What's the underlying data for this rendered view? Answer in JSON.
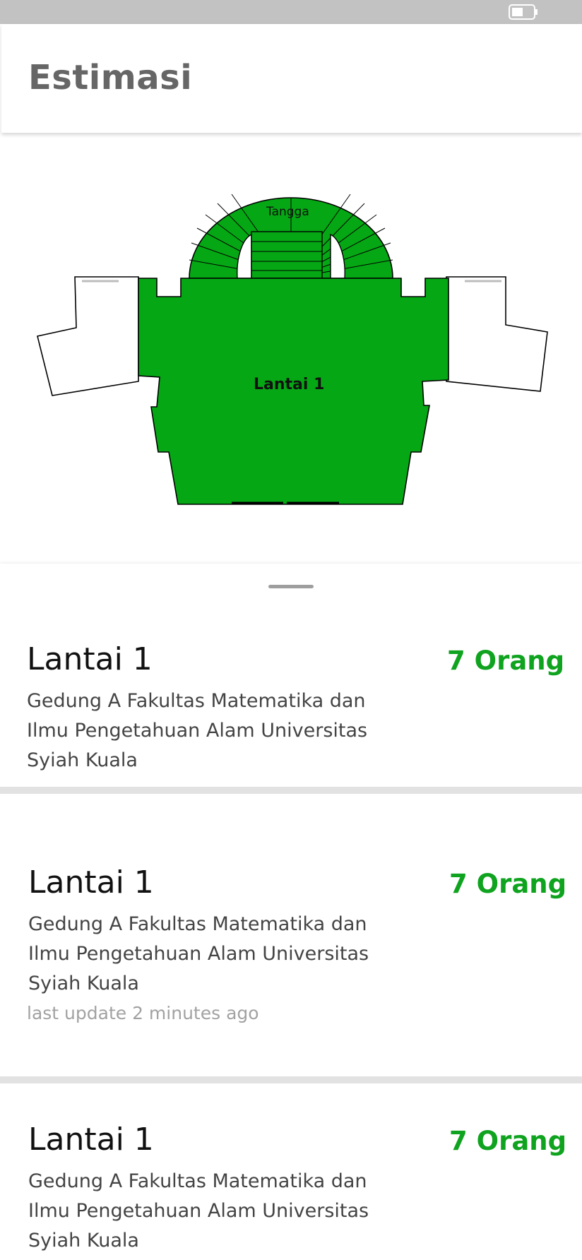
{
  "app_bar": {
    "title": "Estimasi"
  },
  "map": {
    "stair_label": "Tangga",
    "floor_label": "Lantai 1",
    "highlight_color": "#05a814"
  },
  "cards": [
    {
      "title": "Lantai 1",
      "count": "7 Orang",
      "subtitle": "Gedung A Fakultas Matematika dan Ilmu Pengetahuan Alam Universitas Syiah Kuala"
    },
    {
      "title": "Lantai 1",
      "count": "7 Orang",
      "subtitle": "Gedung A Fakultas Matematika dan Ilmu Pengetahuan Alam Universitas Syiah Kuala",
      "update": "last update 2 minutes ago"
    },
    {
      "title": "Lantai 1",
      "count": "7 Orang",
      "subtitle": "Gedung A Fakultas Matematika dan Ilmu Pengetahuan Alam Universitas Syiah Kuala"
    }
  ],
  "colors": {
    "accent": "#0fa31f",
    "status_bar": "#c2c2c2"
  }
}
